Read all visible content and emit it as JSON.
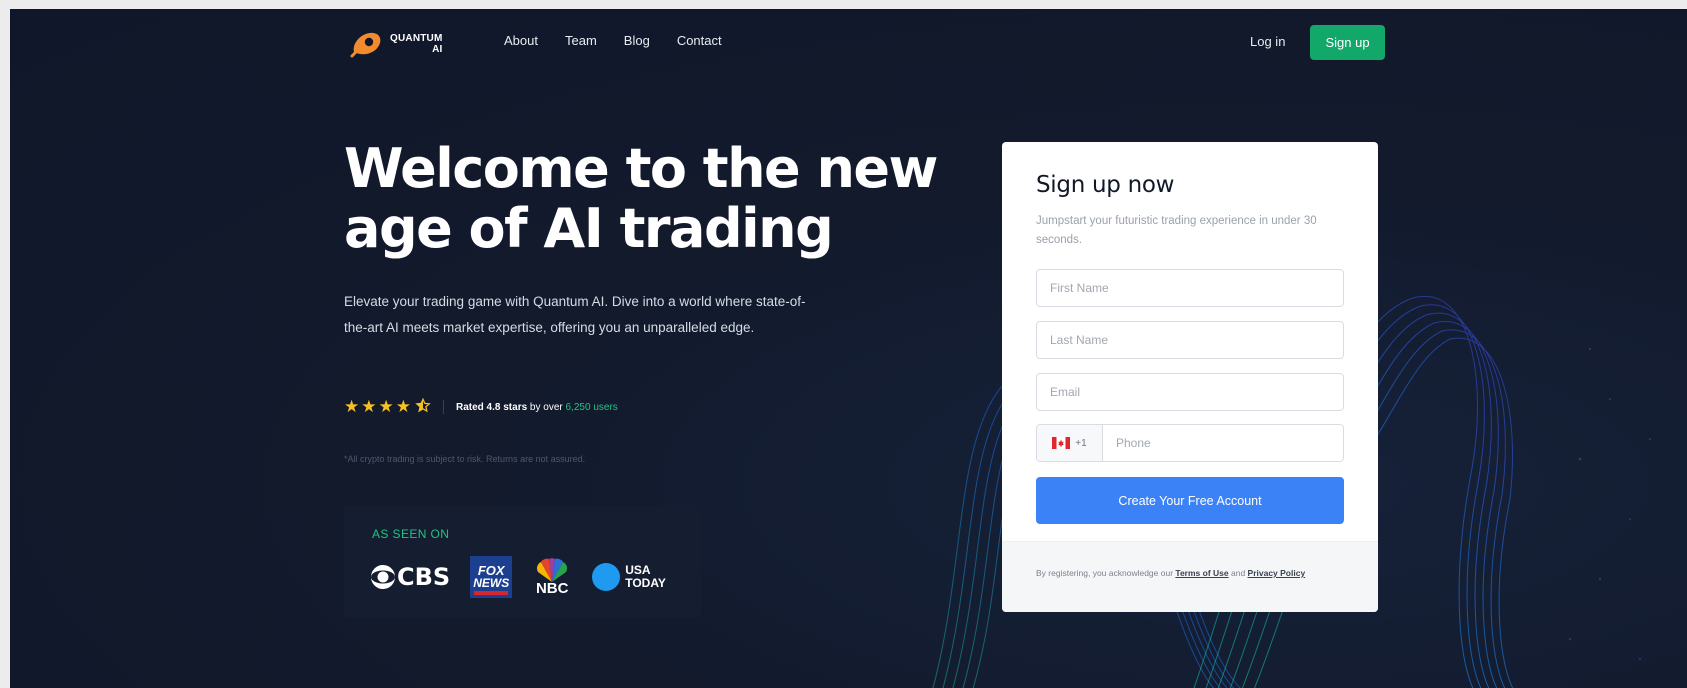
{
  "nav": {
    "logo_line1": "QUANTUM",
    "logo_line2": "AI",
    "links": [
      "About",
      "Team",
      "Blog",
      "Contact"
    ],
    "login": "Log in",
    "signup": "Sign up"
  },
  "hero": {
    "title_line1": "Welcome to the new",
    "title_line2": "age of AI trading",
    "subtitle": "Elevate your trading game with Quantum AI. Dive into a world where state-of-the-art AI meets market expertise, offering you an unparalleled edge.",
    "rating_stars": 4.5,
    "rating_prefix": "Rated 4.8 stars",
    "rating_mid": " by over ",
    "rating_users": "6,250 users",
    "disclaimer": "*All crypto trading is subject to risk. Returns are not assured."
  },
  "press": {
    "label": "AS SEEN ON",
    "cbs": "CBS",
    "fox_line1": "FOX",
    "fox_line2": "NEWS",
    "nbc": "NBC",
    "usa_line1": "USA",
    "usa_line2": "TODAY"
  },
  "form": {
    "title": "Sign up now",
    "subtitle": "Jumpstart your futuristic trading experience in under 30 seconds.",
    "first_name_placeholder": "First Name",
    "last_name_placeholder": "Last Name",
    "email_placeholder": "Email",
    "dial_code": "+1",
    "phone_placeholder": "Phone",
    "submit": "Create Your Free Account",
    "legal_prefix": "By registering, you acknowledge our ",
    "terms": "Terms of Use",
    "legal_and": " and ",
    "privacy": "Privacy Policy"
  },
  "colors": {
    "background": "#121a2c",
    "accent_green": "#11a86a",
    "accent_blue": "#3b82f6",
    "star_gold": "#f5c022"
  }
}
